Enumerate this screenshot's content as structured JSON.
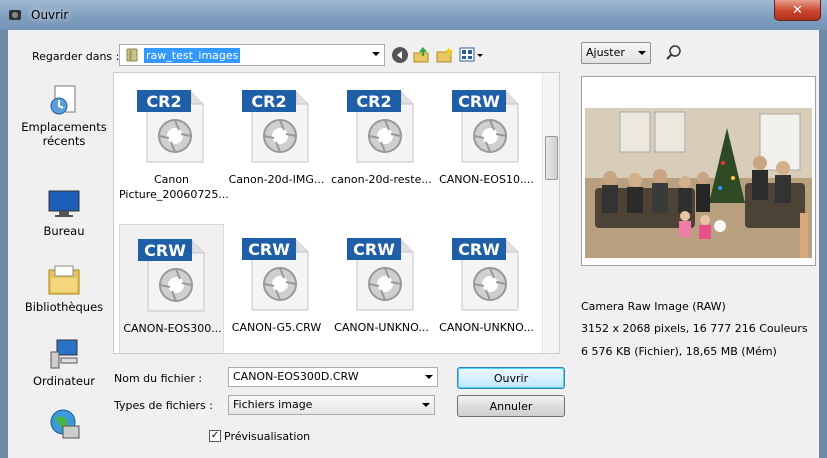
{
  "window": {
    "title": "Ouvrir",
    "close_glyph": "✕"
  },
  "lookin": {
    "label": "Regarder dans :",
    "value": "raw_test_images"
  },
  "places": [
    {
      "label": "Emplacements récents",
      "icon": "recent-places-icon"
    },
    {
      "label": "Bureau",
      "icon": "desktop-icon"
    },
    {
      "label": "Bibliothèques",
      "icon": "libraries-icon"
    },
    {
      "label": "Ordinateur",
      "icon": "computer-icon"
    },
    {
      "label": "",
      "icon": "network-icon"
    }
  ],
  "files": [
    {
      "badge": "CR2",
      "name": "Canon Picture_20060725...",
      "selected": false
    },
    {
      "badge": "CR2",
      "name": "Canon-20d-IMG...",
      "selected": false
    },
    {
      "badge": "CR2",
      "name": "canon-20d-reste...",
      "selected": false
    },
    {
      "badge": "CRW",
      "name": "CANON-EOS10....",
      "selected": false
    },
    {
      "badge": "CRW",
      "name": "CANON-EOS300...",
      "selected": true
    },
    {
      "badge": "CRW",
      "name": "CANON-G5.CRW",
      "selected": false
    },
    {
      "badge": "CRW",
      "name": "CANON-UNKNO...",
      "selected": false
    },
    {
      "badge": "CRW",
      "name": "CANON-UNKNO...",
      "selected": false
    }
  ],
  "filename": {
    "label": "Nom du fichier :",
    "value": "CANON-EOS300D.CRW"
  },
  "filetype": {
    "label": "Types de fichiers :",
    "value": "Fichiers image"
  },
  "buttons": {
    "open": "Ouvrir",
    "cancel": "Annuler"
  },
  "preview_toggle": {
    "label": "Prévisualisation",
    "checked": true
  },
  "preview": {
    "fit": "Ajuster",
    "format": "Camera Raw Image (RAW)",
    "dimensions": "3152 x 2068 pixels, 16 777 216 Couleurs",
    "size": "6 576 KB (Fichier), 18,65 MB (Mém)"
  },
  "colors": {
    "badge_blue": "#1f5fa8",
    "selection": "#3399ff",
    "titlebar": "#8aa7c6"
  }
}
